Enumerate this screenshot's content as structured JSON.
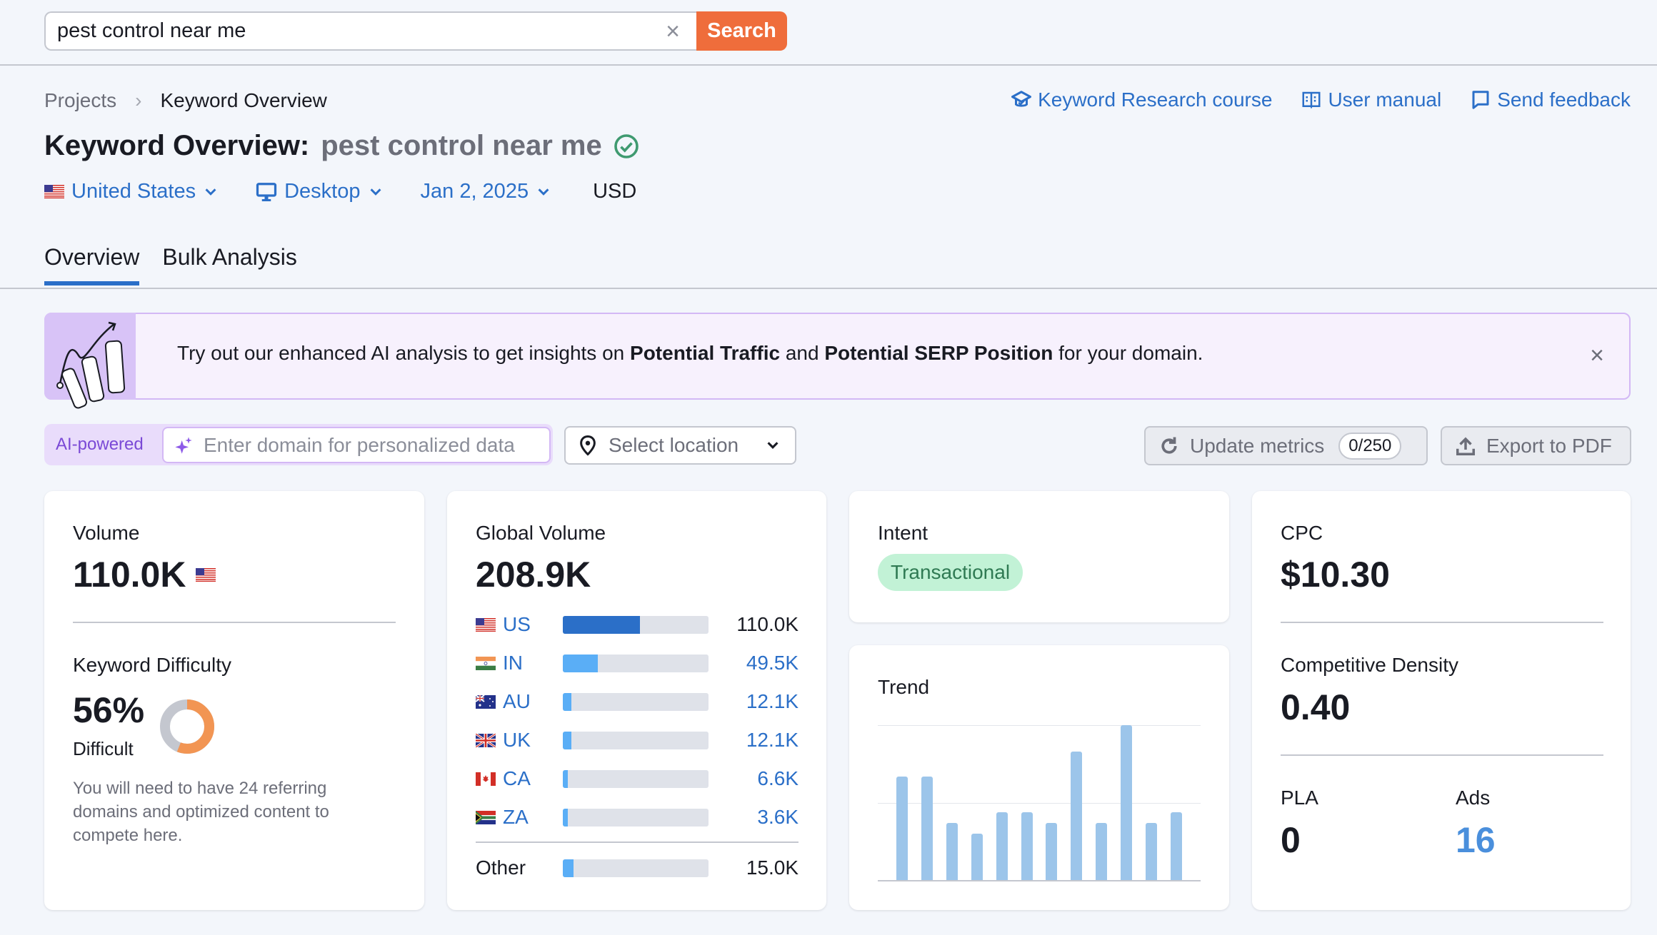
{
  "search": {
    "value": "pest control near me",
    "clear_icon": "×",
    "button_label": "Search"
  },
  "breadcrumb": {
    "items": [
      "Projects",
      "Keyword Overview"
    ],
    "separator": "›"
  },
  "help_links": [
    {
      "label": "Keyword Research course",
      "icon": "graduation-cap-icon"
    },
    {
      "label": "User manual",
      "icon": "book-icon"
    },
    {
      "label": "Send feedback",
      "icon": "chat-bubble-icon"
    }
  ],
  "title": {
    "prefix": "Keyword Overview:",
    "keyword": "pest control near me",
    "status_icon": "check-circle-icon"
  },
  "selectors": {
    "country": "United States",
    "device": "Desktop",
    "date": "Jan 2, 2025",
    "currency": "USD"
  },
  "tabs": [
    {
      "label": "Overview",
      "active": true
    },
    {
      "label": "Bulk Analysis",
      "active": false
    }
  ],
  "banner": {
    "text_before": "Try out our enhanced AI analysis to get insights on ",
    "bold1": "Potential Traffic",
    "text_mid": " and ",
    "bold2": "Potential SERP Position",
    "text_after": " for your domain.",
    "close_icon": "×"
  },
  "ai_row": {
    "badge": "AI-powered",
    "domain_placeholder": "Enter domain for personalized data",
    "location_placeholder": "Select location",
    "update_label": "Update metrics",
    "update_count": "0/250",
    "export_label": "Export to PDF"
  },
  "volume": {
    "label": "Volume",
    "value": "110.0K",
    "flag": "US"
  },
  "keyword_difficulty": {
    "label": "Keyword Difficulty",
    "value": "56%",
    "percent": 56,
    "level": "Difficult",
    "description": "You will need to have 24 referring domains and optimized content to compete here.",
    "color": "#f29553"
  },
  "global_volume": {
    "label": "Global Volume",
    "value": "208.9K",
    "countries": [
      {
        "code": "US",
        "value": "110.0K",
        "share": 0.53,
        "linked": false
      },
      {
        "code": "IN",
        "value": "49.5K",
        "share": 0.24,
        "linked": true
      },
      {
        "code": "AU",
        "value": "12.1K",
        "share": 0.058,
        "linked": true
      },
      {
        "code": "UK",
        "value": "12.1K",
        "share": 0.058,
        "linked": true
      },
      {
        "code": "CA",
        "value": "6.6K",
        "share": 0.032,
        "linked": true
      },
      {
        "code": "ZA",
        "value": "3.6K",
        "share": 0.032,
        "linked": true
      }
    ],
    "other": {
      "label": "Other",
      "value": "15.0K",
      "share": 0.072
    }
  },
  "intent": {
    "label": "Intent",
    "value": "Transactional"
  },
  "trend": {
    "label": "Trend",
    "relative_values": [
      0.67,
      0.67,
      0.37,
      0.3,
      0.44,
      0.44,
      0.37,
      0.83,
      0.37,
      1.0,
      0.37,
      0.44
    ]
  },
  "cpc": {
    "label": "CPC",
    "value": "$10.30"
  },
  "competitive_density": {
    "label": "Competitive Density",
    "value": "0.40"
  },
  "pla": {
    "label": "PLA",
    "value": "0"
  },
  "ads": {
    "label": "Ads",
    "value": "16"
  },
  "colors": {
    "accent": "#2b6fc8",
    "search_button": "#ef6d3b",
    "us_bar": "#2b6fc8",
    "other_bars": "#5aaef6",
    "trend_bar": "#9cc5ea",
    "intent_bg": "#c2f2d6",
    "ai_purple": "#7a49d6"
  }
}
